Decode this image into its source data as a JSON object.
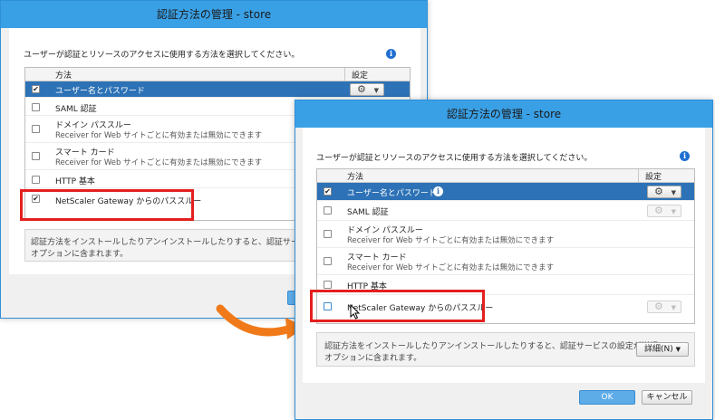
{
  "dialog_title": "認証方法の管理 - store",
  "description": "ユーザーが認証とリソースのアクセスに使用する方法を選択してください。",
  "table": {
    "col_method": "方法",
    "col_settings": "設定"
  },
  "methods": [
    {
      "name": "ユーザー名とパスワード",
      "sub": ""
    },
    {
      "name": "SAML 認証",
      "sub": ""
    },
    {
      "name": "ドメイン パススルー",
      "sub": "Receiver for Web サイトごとに有効または無効にできます"
    },
    {
      "name": "スマート カード",
      "sub": "Receiver for Web サイトごとに有効または無効にできます"
    },
    {
      "name": "HTTP 基本",
      "sub": ""
    },
    {
      "name": "NetScaler Gateway からのパススルー",
      "sub": ""
    }
  ],
  "info_text_line1": "認証方法をインストールしたりアンインストールしたりすると、認証サービスの設定が詳細",
  "info_text_line2": "オプションに含まれます。",
  "back_info_line1": "認証方法をインストールしたりアンインストールしたりすると、認証サービスの設",
  "detail_button": "詳細(N)",
  "ok_button": "OK",
  "cancel_button": "キャンセル",
  "icons": {
    "check": "✔",
    "gear": "⚙",
    "caret": "▼",
    "info": "i"
  },
  "colors": {
    "titlebar": "#3aa0e6",
    "selected_row": "#2d72b6",
    "highlight_box": "#e31f1f",
    "arrow": "#f07a1a"
  }
}
